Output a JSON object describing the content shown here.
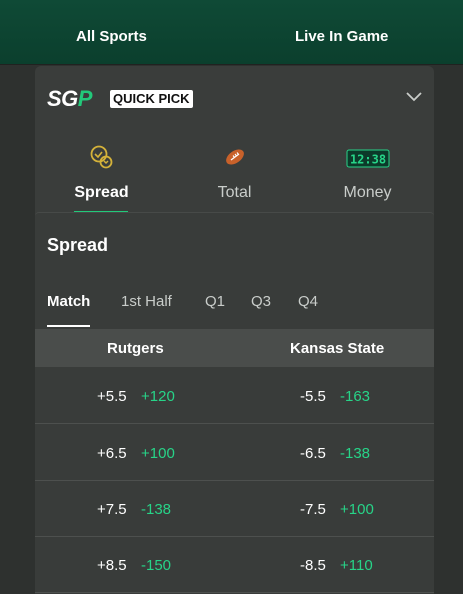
{
  "top_nav": {
    "all_sports": "All Sports",
    "live_in_game": "Live In Game"
  },
  "sgp": {
    "logo_s": "SG",
    "logo_p": "P",
    "badge": "QUICK PICK"
  },
  "bet_types": [
    {
      "label": "Spread",
      "icon": "spread-icon",
      "active": true
    },
    {
      "label": "Total",
      "icon": "football-icon",
      "active": false
    },
    {
      "label": "Money",
      "icon": "scoreboard-icon",
      "active": false,
      "icon_text": "12:38"
    }
  ],
  "section": {
    "title": "Spread"
  },
  "periods": [
    {
      "label": "Match",
      "active": true
    },
    {
      "label": "1st Half",
      "active": false
    },
    {
      "label": "Q1",
      "active": false
    },
    {
      "label": "Q3",
      "active": false
    },
    {
      "label": "Q4",
      "active": false
    }
  ],
  "teams": {
    "home": "Rutgers",
    "away": "Kansas State"
  },
  "rows": [
    {
      "home_line": "+5.5",
      "home_odds": "+120",
      "away_line": "-5.5",
      "away_odds": "-163"
    },
    {
      "home_line": "+6.5",
      "home_odds": "+100",
      "away_line": "-6.5",
      "away_odds": "-138"
    },
    {
      "home_line": "+7.5",
      "home_odds": "-138",
      "away_line": "-7.5",
      "away_odds": "+100"
    },
    {
      "home_line": "+8.5",
      "home_odds": "-150",
      "away_line": "-8.5",
      "away_odds": "+110"
    }
  ],
  "colors": {
    "accent_green": "#27d488",
    "nav_green": "#0f4a36",
    "icon_gold": "#d4b23a"
  }
}
